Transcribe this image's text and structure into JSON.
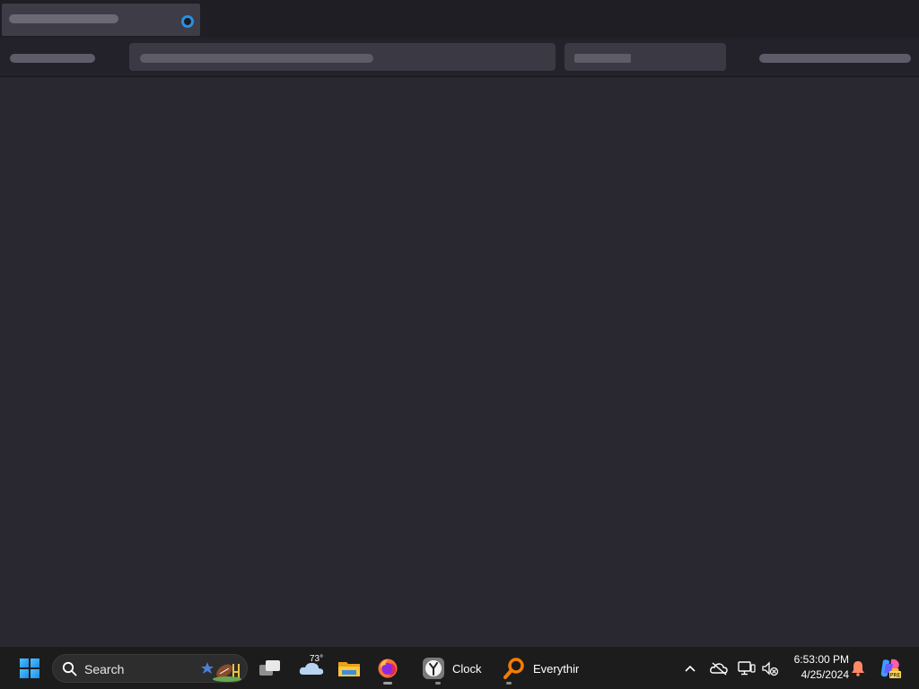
{
  "taskbar": {
    "search_label": "Search",
    "weather_temp": "73°",
    "apps": {
      "clock_label": "Clock",
      "everything_label": "Everythir"
    },
    "time": "6:53:00 PM",
    "date": "4/25/2024"
  },
  "icons": {
    "start": "windows-logo-icon",
    "search": "search-icon",
    "task_view": "task-view-icon",
    "weather": "weather-cloud-icon",
    "explorer": "file-explorer-icon",
    "firefox": "firefox-icon",
    "clock": "clock-icon",
    "everything": "everything-search-icon",
    "tray_chevron": "chevron-up-icon",
    "onedrive": "onedrive-offline-icon",
    "network": "network-icon",
    "volume": "volume-muted-icon",
    "notifications": "bell-icon",
    "copilot": "copilot-icon"
  },
  "colors": {
    "accent_blue": "#2a8fe0",
    "taskbar_bg": "#1c1c1c",
    "content_bg": "#292830"
  }
}
